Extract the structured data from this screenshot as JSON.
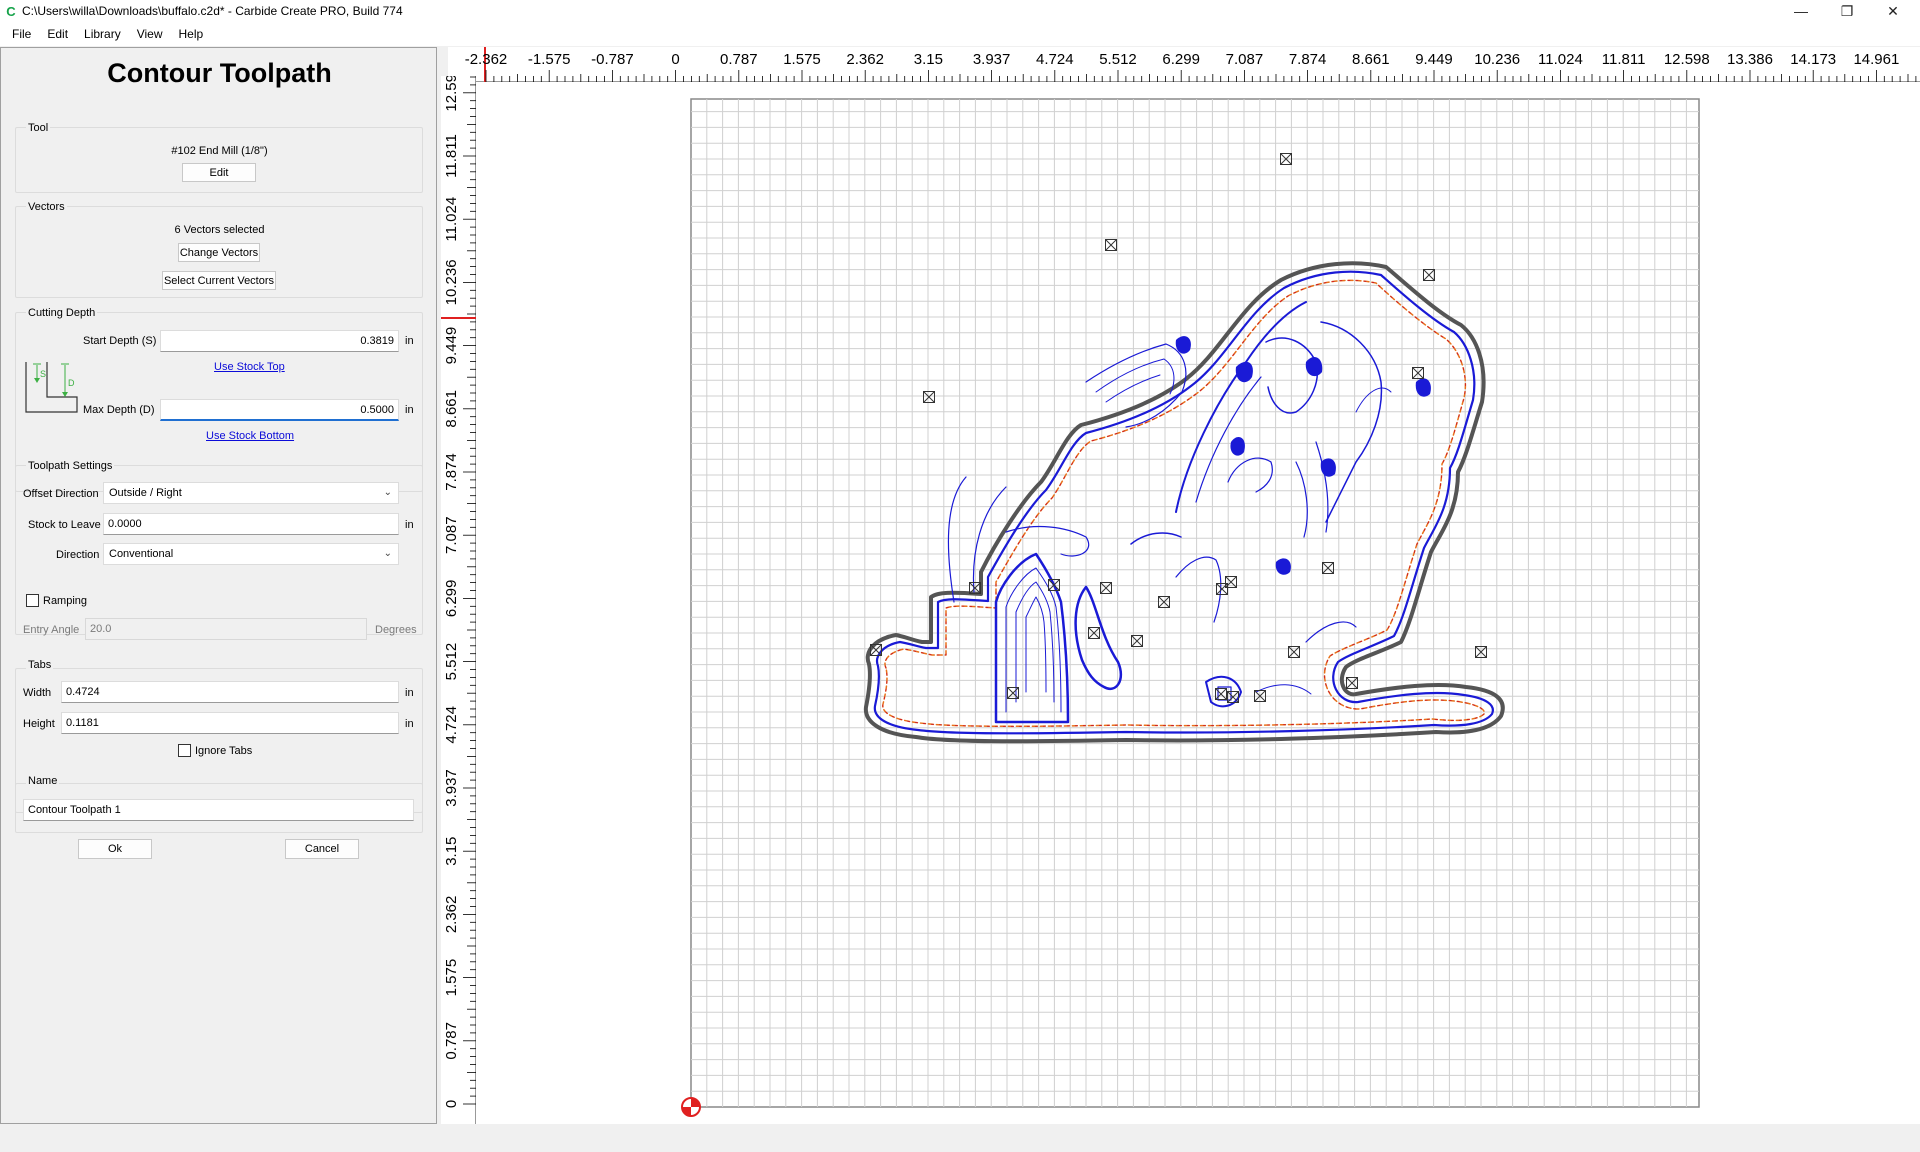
{
  "window": {
    "title": "C:\\Users\\willa\\Downloads\\buffalo.c2d* - Carbide Create PRO, Build 774",
    "minimize_glyph": "—",
    "restore_glyph": "❐",
    "close_glyph": "✕",
    "app_icon": "carbide-c-icon"
  },
  "menu": [
    "File",
    "Edit",
    "Library",
    "View",
    "Help"
  ],
  "panel": {
    "title": "Contour Toolpath",
    "tool": {
      "label": "Tool",
      "name": "#102 End Mill (1/8\")",
      "edit_button": "Edit"
    },
    "vectors": {
      "label": "Vectors",
      "selected_text": "6 Vectors selected",
      "change_button": "Change Vectors",
      "select_current_button": "Select Current Vectors"
    },
    "cutting_depth": {
      "label": "Cutting Depth",
      "start_label": "Start Depth (S)",
      "start_value": "0.3819",
      "start_unit": "in",
      "use_stock_top": "Use Stock Top",
      "max_label": "Max Depth (D)",
      "max_value": "0.5000",
      "max_unit": "in",
      "use_stock_bottom": "Use Stock Bottom",
      "diagram_s": "S",
      "diagram_d": "D"
    },
    "toolpath_settings": {
      "label": "Toolpath Settings",
      "offset_label": "Offset Direction",
      "offset_value": "Outside / Right",
      "stock_label": "Stock to Leave",
      "stock_value": "0.0000",
      "stock_unit": "in",
      "direction_label": "Direction",
      "direction_value": "Conventional"
    },
    "ramping": {
      "label": "Ramping",
      "checked": false,
      "entry_angle_label": "Entry Angle",
      "entry_angle_value": "20.0",
      "entry_angle_unit": "Degrees"
    },
    "tabs": {
      "label": "Tabs",
      "width_label": "Width",
      "width_value": "0.4724",
      "width_unit": "in",
      "height_label": "Height",
      "height_value": "0.1181",
      "height_unit": "in",
      "ignore_label": "Ignore Tabs",
      "ignore_checked": false
    },
    "name": {
      "label": "Name",
      "value": "Contour Toolpath 1"
    },
    "ok_button": "Ok",
    "cancel_button": "Cancel"
  },
  "rulers": {
    "top_labels": [
      "-2.362",
      "-1.575",
      "-0.787",
      "0",
      "0.787",
      "1.575",
      "2.362",
      "3.15",
      "3.937",
      "4.724",
      "5.512",
      "6.299",
      "7.087",
      "7.874",
      "8.661",
      "9.449",
      "10.236",
      "11.024",
      "11.811",
      "12.598",
      "13.386",
      "14.173",
      "14.961"
    ],
    "left_labels": [
      "12.59",
      "11.811",
      "11.024",
      "10.236",
      "9.449",
      "8.661",
      "7.874",
      "7.087",
      "6.299",
      "5.512",
      "4.724",
      "3.937",
      "3.15",
      "2.362",
      "1.575",
      "0.787",
      "0"
    ],
    "unit_spacing": 0.787
  },
  "colors": {
    "toolpath_blue": "#1a1ad6",
    "tab_orange": "#e8711a",
    "tab_red": "#c8102e",
    "outline_gray": "#555555",
    "grid": "#d0d0d0",
    "origin_red": "#e02020",
    "link_blue": "#0b0bd8",
    "diagram_green": "#3cb043"
  }
}
